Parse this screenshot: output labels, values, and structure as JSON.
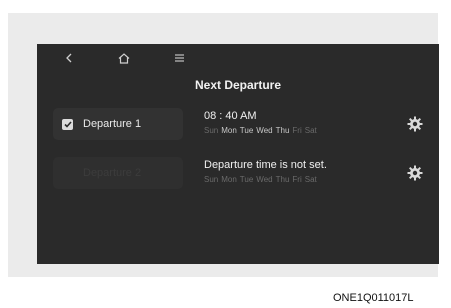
{
  "header": {
    "title": "Next Departure"
  },
  "departures": [
    {
      "label": "Departure 1",
      "checked": true,
      "time_text": "08 : 40 AM",
      "days": [
        {
          "label": "Sun",
          "active": false
        },
        {
          "label": "Mon",
          "active": true
        },
        {
          "label": "Tue",
          "active": true
        },
        {
          "label": "Wed",
          "active": true
        },
        {
          "label": "Thu",
          "active": true
        },
        {
          "label": "Fri",
          "active": false
        },
        {
          "label": "Sat",
          "active": false
        }
      ]
    },
    {
      "label": "Departure 2",
      "checked": false,
      "time_text": "Departure time is not set.",
      "days": [
        {
          "label": "Sun",
          "active": false
        },
        {
          "label": "Mon",
          "active": false
        },
        {
          "label": "Tue",
          "active": false
        },
        {
          "label": "Wed",
          "active": false
        },
        {
          "label": "Thu",
          "active": false
        },
        {
          "label": "Fri",
          "active": false
        },
        {
          "label": "Sat",
          "active": false
        }
      ]
    }
  ],
  "icons": {
    "back": "chevron-left-icon",
    "home": "home-icon",
    "menu": "menu-icon",
    "settings": "gear-icon"
  },
  "caption": "ONE1Q011017L"
}
